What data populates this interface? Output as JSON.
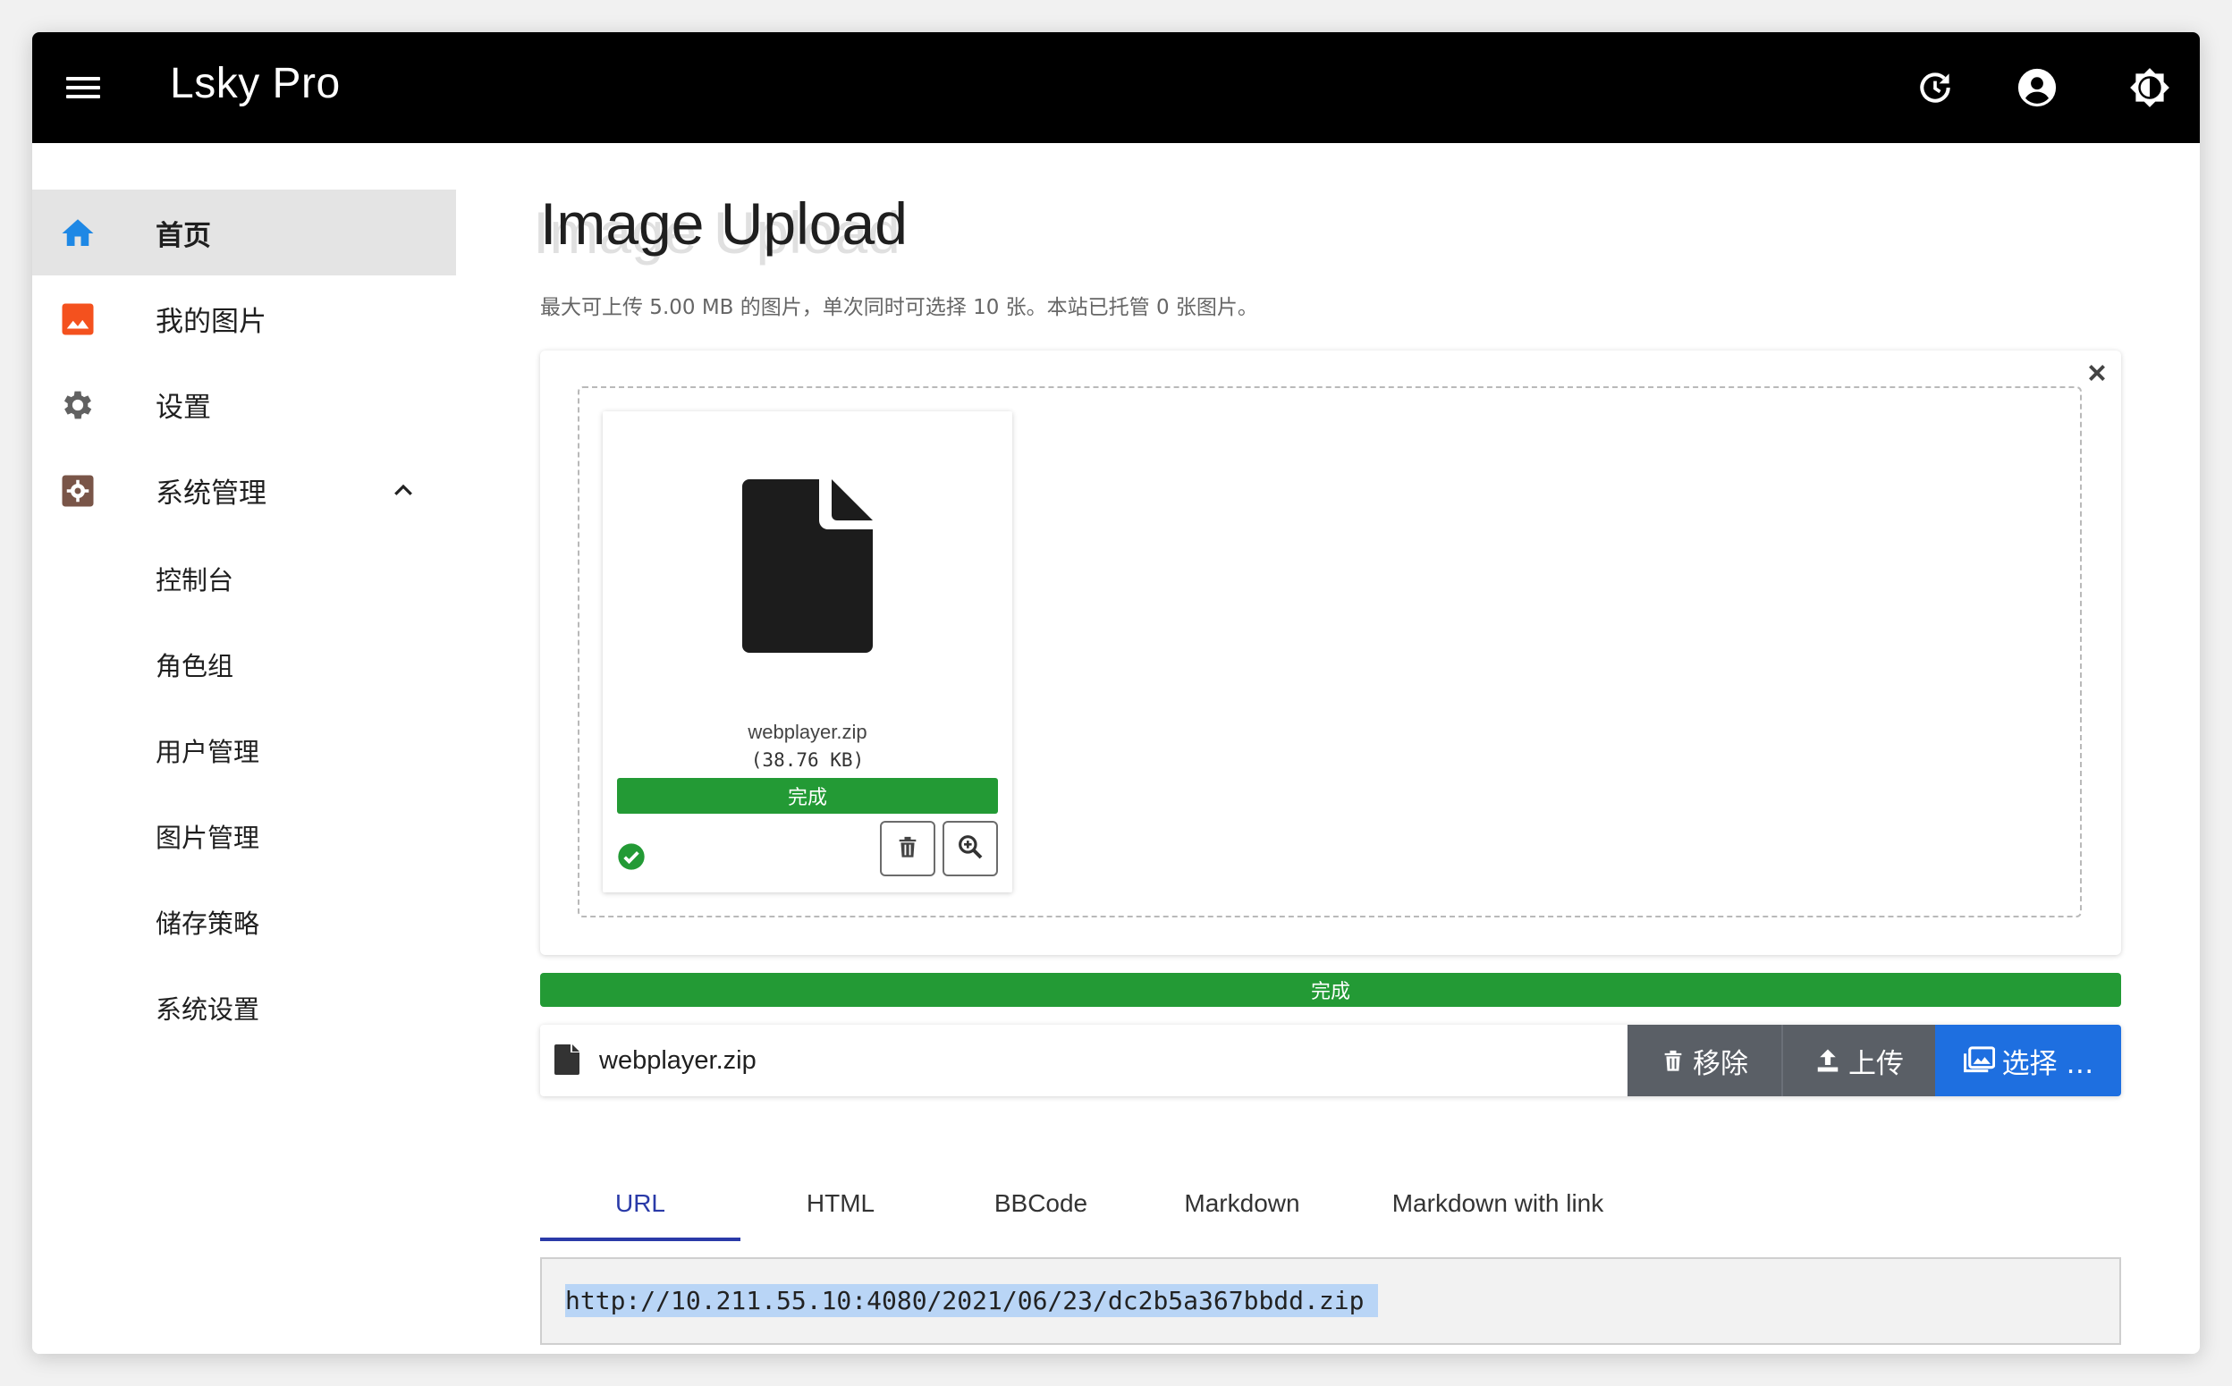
{
  "app": {
    "title": "Lsky Pro"
  },
  "appbar": {
    "icons": [
      "menu-icon",
      "history-icon",
      "account-icon",
      "brightness-icon"
    ]
  },
  "sidebar": {
    "items": [
      {
        "label": "首页",
        "icon": "home-icon",
        "color": "#1e88e5",
        "active": true
      },
      {
        "label": "我的图片",
        "icon": "image-icon",
        "color": "#f4511e"
      },
      {
        "label": "设置",
        "icon": "gear-icon",
        "color": "#616161"
      },
      {
        "label": "系统管理",
        "icon": "admin-icon",
        "color": "#795548",
        "expanded": true
      }
    ],
    "sub_items": [
      "控制台",
      "角色组",
      "用户管理",
      "图片管理",
      "储存策略",
      "系统设置"
    ]
  },
  "main": {
    "title": "Image Upload",
    "subtitle": "最大可上传 5.00 MB 的图片，单次同时可选择 10 张。本站已托管 0 张图片。"
  },
  "upload_card": {
    "file_name": "webplayer.zip",
    "file_size": "(38.76 KB)",
    "status": "完成"
  },
  "progress": {
    "label": "完成",
    "value": 1.0
  },
  "file_row": {
    "file_name": "webplayer.zip",
    "remove_label": "移除",
    "upload_label": "上传",
    "select_label": "选择 …"
  },
  "tabs": [
    {
      "label": "URL",
      "active": true
    },
    {
      "label": "HTML"
    },
    {
      "label": "BBCode"
    },
    {
      "label": "Markdown"
    },
    {
      "label": "Markdown with link"
    }
  ],
  "output": {
    "url": "http://10.211.55.10:4080/2021/06/23/dc2b5a367bbdd.zip"
  },
  "colors": {
    "appbar": "#000000",
    "success": "#239a35",
    "primary": "#1e6fe0",
    "button_gray": "#5a5f66",
    "tab_active": "#2a3aa8"
  }
}
